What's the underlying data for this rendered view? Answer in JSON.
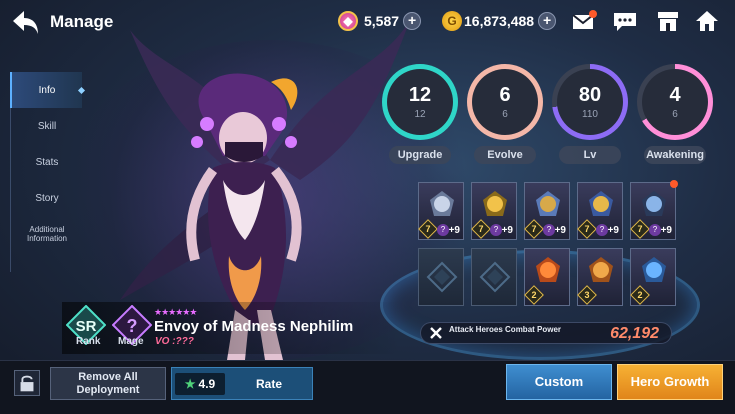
{
  "header": {
    "title": "Manage",
    "currencies": [
      {
        "icon": "crystal-icon",
        "value": "5,587"
      },
      {
        "icon": "gold-coin-icon",
        "value": "16,873,488"
      }
    ]
  },
  "tabs": [
    "Info",
    "Skill",
    "Stats",
    "Story",
    "Additional Information"
  ],
  "stats": [
    {
      "label": "Upgrade",
      "value": "12",
      "max": "12",
      "color": "#2fd6c8",
      "fill": 1.0
    },
    {
      "label": "Evolve",
      "value": "6",
      "max": "6",
      "color": "#f4b7a8",
      "fill": 1.0
    },
    {
      "label": "Lv",
      "value": "80",
      "max": "110",
      "color": "#8d6cf5",
      "fill": 0.727
    },
    {
      "label": "Awakening",
      "value": "4",
      "max": "6",
      "color": "#ff8fd8",
      "fill": 0.667
    }
  ],
  "equipment": {
    "row1": [
      {
        "icon": "axe-weapon-icon",
        "level": "7",
        "enchant": "?",
        "plus": "+9"
      },
      {
        "icon": "gem-accessory-icon",
        "level": "7",
        "enchant": "?",
        "plus": "+9"
      },
      {
        "icon": "winged-helm-icon",
        "level": "7",
        "enchant": "?",
        "plus": "+9"
      },
      {
        "icon": "gold-armor-icon",
        "level": "7",
        "enchant": "?",
        "plus": "+9"
      },
      {
        "icon": "sword-shield-icon",
        "level": "7",
        "enchant": "?",
        "plus": "+9"
      }
    ],
    "row2": [
      {
        "icon": "empty-slot-icon",
        "level": ""
      },
      {
        "icon": "empty-slot-icon",
        "level": ""
      },
      {
        "icon": "flame-orb-icon",
        "level": "2"
      },
      {
        "icon": "lion-medallion-icon",
        "level": "3"
      },
      {
        "icon": "blue-scepter-icon",
        "level": "2"
      }
    ]
  },
  "hero": {
    "rank": "SR",
    "rank_label": "Rank",
    "class_label": "Mage",
    "stars": "★★★★★★",
    "name": "Envoy of Madness Nephilim",
    "vo": "VO :???"
  },
  "combat": {
    "label": "Attack Heroes Combat Power",
    "value": "62,192"
  },
  "bottom": {
    "remove_label": "Remove All Deployment",
    "rating": "4.9",
    "rate_label": "Rate",
    "custom_label": "Custom",
    "growth_label": "Hero Growth"
  }
}
